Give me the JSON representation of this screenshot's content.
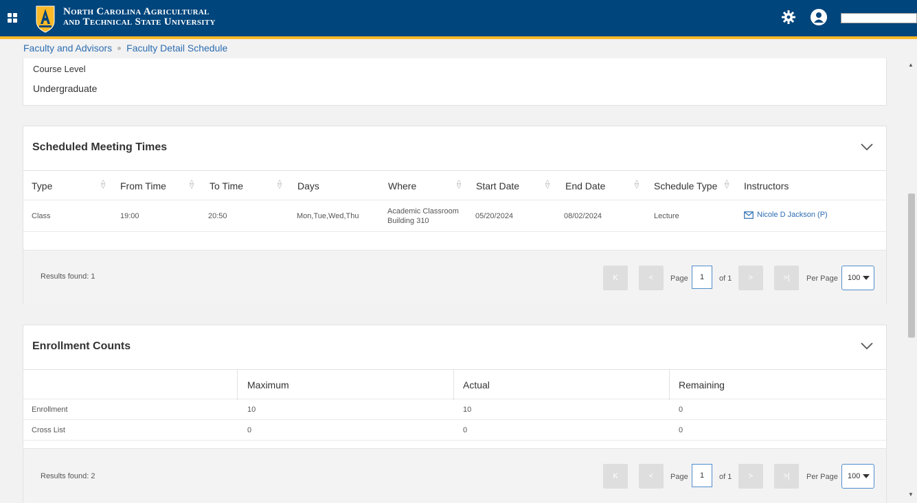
{
  "header": {
    "university_line1": "North Carolina Agricultural",
    "university_line2": "and Technical State University",
    "icons": [
      "apps-grid-icon",
      "university-logo",
      "settings-gear-icon",
      "user-icon"
    ],
    "colors": {
      "primary": "#00457c",
      "accent": "#fdb927"
    }
  },
  "breadcrumb": {
    "items": [
      "Faculty and Advisors",
      "Faculty Detail Schedule"
    ]
  },
  "course_level": {
    "label": "Course Level",
    "value": "Undergraduate"
  },
  "meeting_times": {
    "title": "Scheduled Meeting Times",
    "columns": [
      "Type",
      "From Time",
      "To Time",
      "Days",
      "Where",
      "Start Date",
      "End Date",
      "Schedule Type",
      "Instructors"
    ],
    "rows": [
      {
        "type": "Class",
        "from": "19:00",
        "to": "20:50",
        "days": "Mon,Tue,Wed,Thu",
        "where_line1": "Academic Classroom",
        "where_line2": "Building 310",
        "start": "05/20/2024",
        "end": "08/02/2024",
        "schedule_type": "Lecture",
        "instructor": "Nicole D Jackson (P)"
      }
    ],
    "results": "Results found: 1",
    "pager": {
      "page_label": "Page",
      "page": "1",
      "of": "of 1",
      "per_page_label": "Per Page",
      "per_page": "100"
    }
  },
  "enrollment": {
    "title": "Enrollment Counts",
    "columns": [
      "",
      "Maximum",
      "Actual",
      "Remaining"
    ],
    "rows": [
      {
        "label": "Enrollment",
        "maximum": "10",
        "actual": "10",
        "remaining": "0"
      },
      {
        "label": "Cross List",
        "maximum": "0",
        "actual": "0",
        "remaining": "0"
      }
    ],
    "results": "Results found: 2",
    "pager": {
      "page_label": "Page",
      "page": "1",
      "of": "of 1",
      "per_page_label": "Per Page",
      "per_page": "100"
    }
  }
}
